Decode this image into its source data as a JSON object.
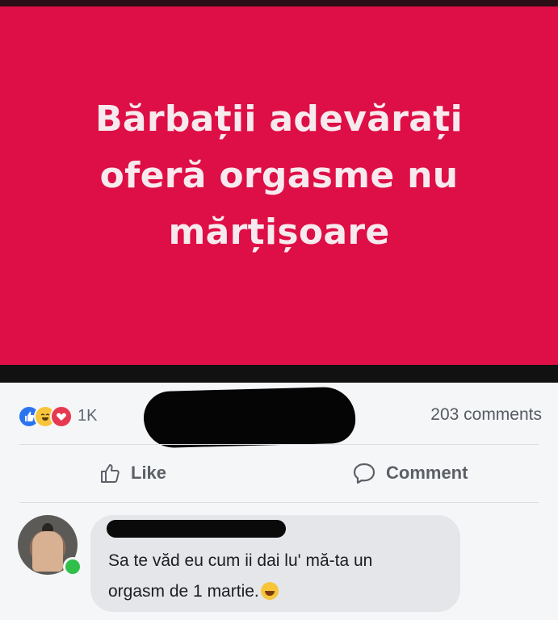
{
  "banner": {
    "line1": "Bărbații adevărați",
    "line2": "oferă orgasme nu",
    "line3": "mărțișoare",
    "background_color": "#de0f46"
  },
  "stats": {
    "reaction_icons": [
      "like-icon",
      "haha-icon",
      "love-icon"
    ],
    "reaction_count": "1K",
    "comment_count": "203 comments"
  },
  "actions": {
    "like_label": "Like",
    "comment_label": "Comment"
  },
  "comment": {
    "text_line1": "Sa te văd eu cum ii dai lu' mă-ta un",
    "text_line2": "orgasm de 1 martie.",
    "emoji": "laughing-emoji"
  }
}
